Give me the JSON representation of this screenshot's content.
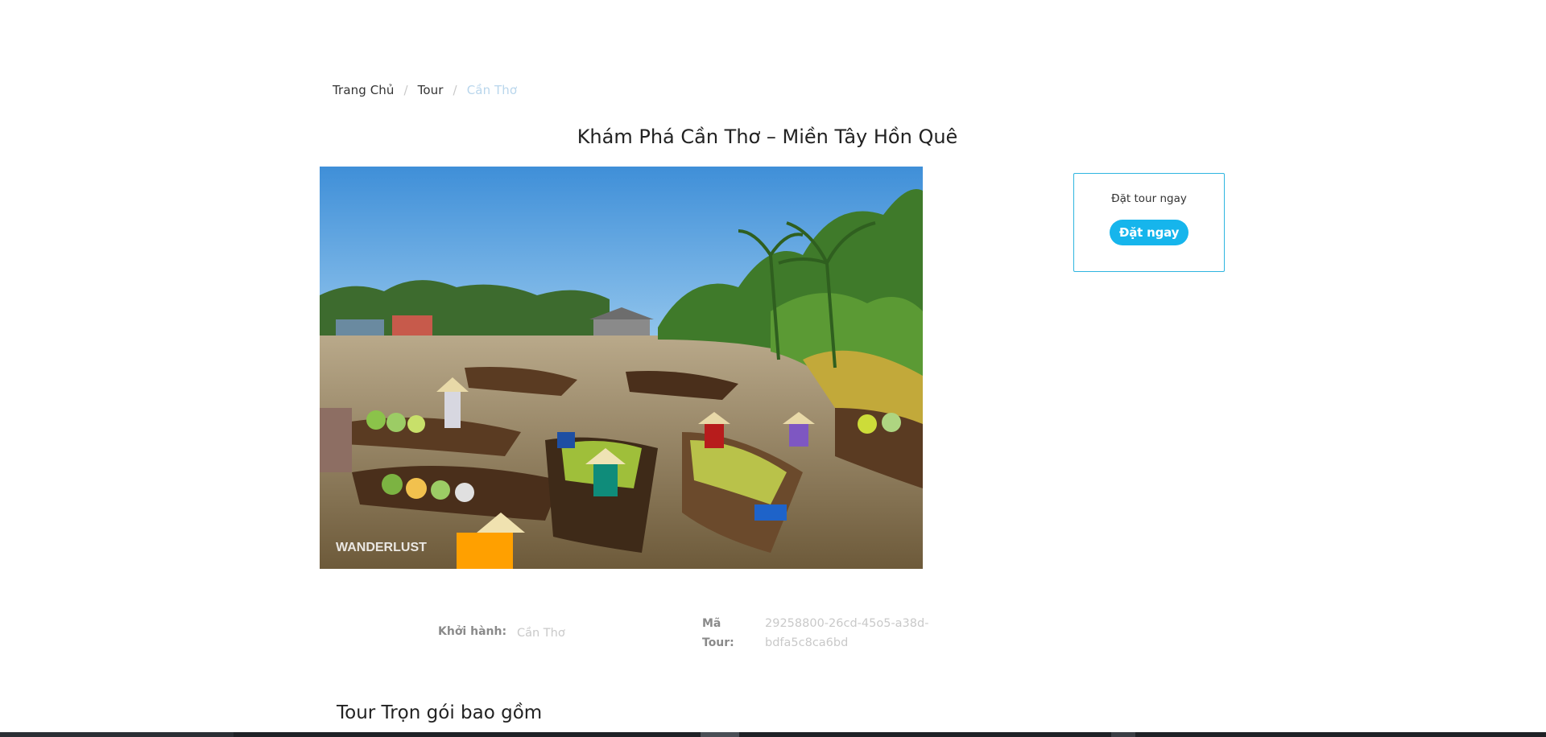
{
  "breadcrumb": {
    "items": [
      "Trang Chủ",
      "Tour"
    ],
    "current": "Cần Thơ"
  },
  "page_title": "Khám Phá Cần Thơ – Miền Tây Hồn Quê",
  "hero": {
    "watermark": "WANDERLUST"
  },
  "booking_card": {
    "label": "Đặt tour ngay",
    "button_label": "Đặt ngay",
    "accent_color": "#16b5ec",
    "border_color": "#2fb5e0"
  },
  "tour_info": {
    "departure_label": "Khởi hành:",
    "departure_value": "Cần Thơ",
    "code_label_line1": "Mã",
    "code_label_line2": "Tour:",
    "code_value_line1": "29258800-26cd-45o5-a38d-",
    "code_value_line2": "bdfa5c8ca6bd"
  },
  "package_section": {
    "title": "Tour Trọn gói bao gồm"
  }
}
